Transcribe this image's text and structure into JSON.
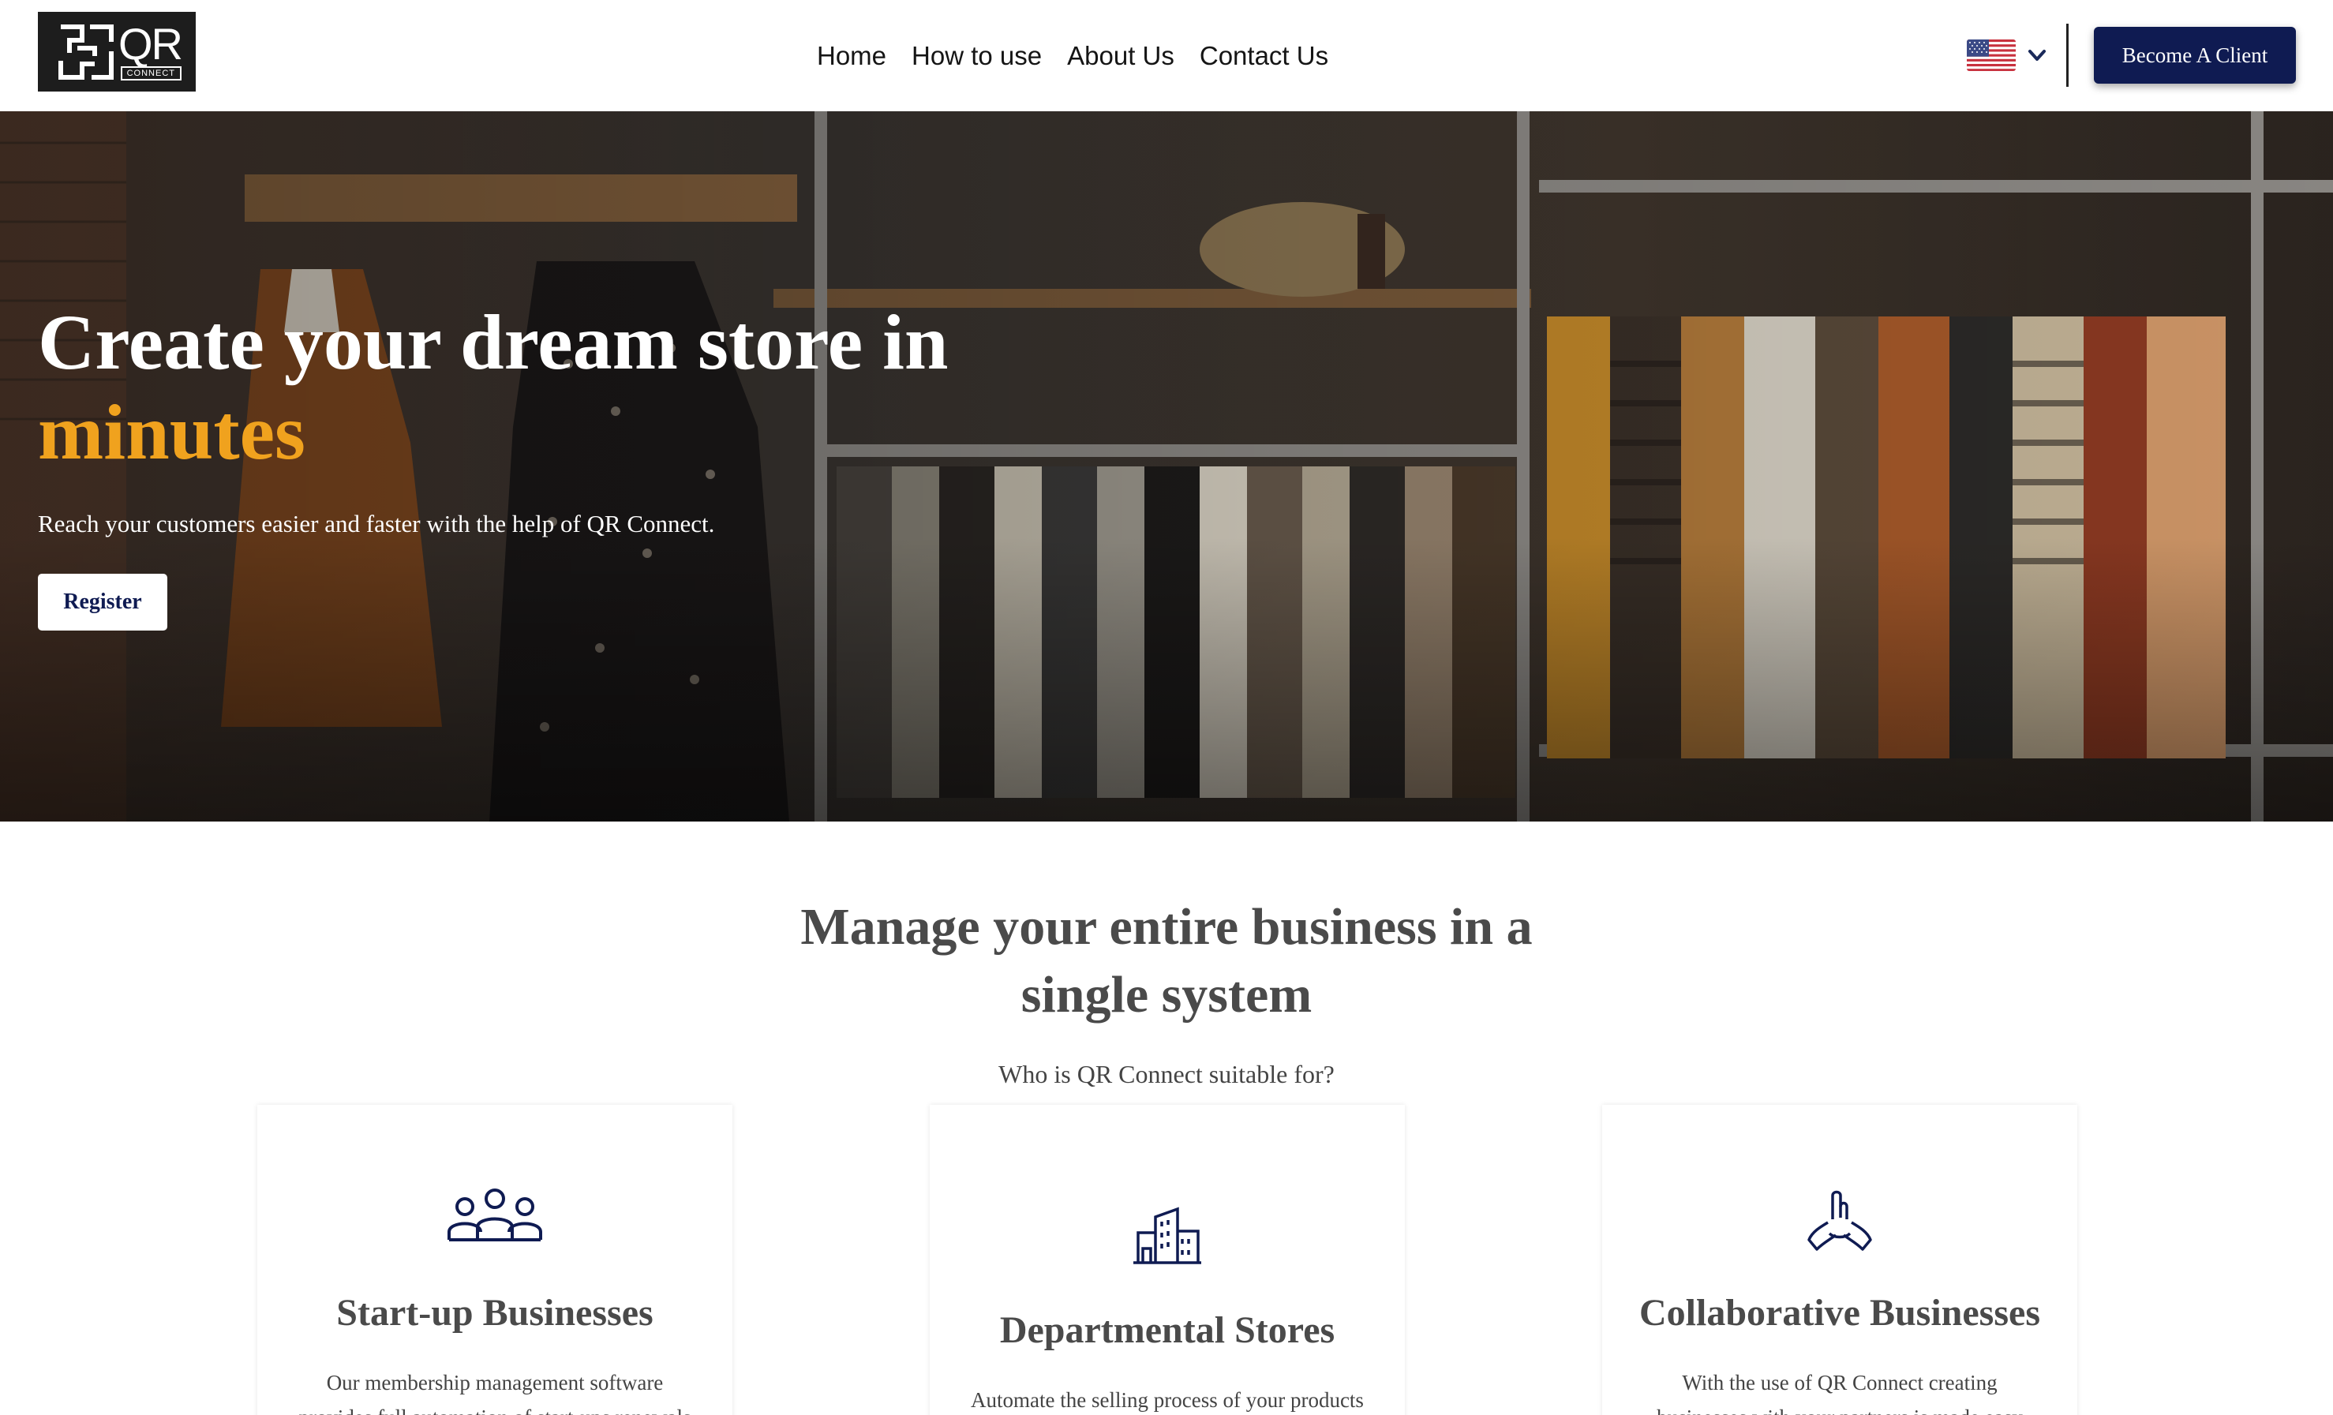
{
  "header": {
    "logo": {
      "text": "QR",
      "subtext": "CONNECT"
    },
    "nav": [
      {
        "label": "Home"
      },
      {
        "label": "How to use"
      },
      {
        "label": "About Us"
      },
      {
        "label": "Contact Us"
      }
    ],
    "language": {
      "icon": "us-flag-icon",
      "chevron": "chevron-down-icon"
    },
    "cta_label": "Become A Client"
  },
  "hero": {
    "title_line1": "Create your dream store in",
    "title_accent": "minutes",
    "subtitle": "Reach your customers easier and faster with the help of QR Connect.",
    "button_label": "Register",
    "accent_color": "#f0a21e"
  },
  "features": {
    "title": "Manage your entire business in a single system",
    "subtitle": "Who is QR Connect suitable for?",
    "cards": [
      {
        "icon": "team-icon",
        "title": "Start-up Businesses",
        "text": "Our membership management software provides full automation of start-ups renewals"
      },
      {
        "icon": "buildings-icon",
        "title": "Departmental Stores",
        "text": "Automate the selling process of your products"
      },
      {
        "icon": "collaboration-hands-icon",
        "title": "Collaborative Businesses",
        "text": "With the use of QR Connect creating businesses with your partners is made easy"
      }
    ]
  },
  "colors": {
    "brand_navy": "#0f1b52",
    "accent": "#f0a21e",
    "logo_bg": "#1d1d1d"
  }
}
